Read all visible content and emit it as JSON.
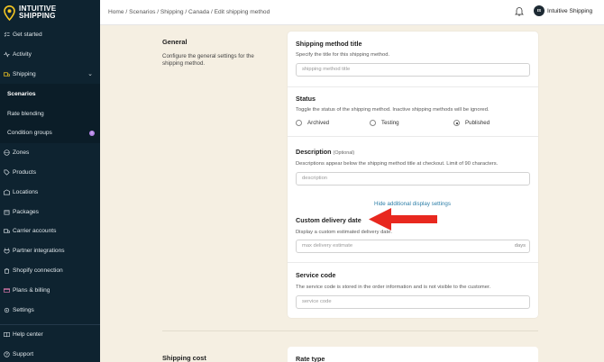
{
  "brand": {
    "line1": "INTUITIVE",
    "line2": "SHIPPING"
  },
  "sidebar": {
    "items": [
      {
        "label": "Get started",
        "icon": "checklist-icon"
      },
      {
        "label": "Activity",
        "icon": "activity-icon"
      },
      {
        "label": "Shipping",
        "icon": "truck-icon"
      },
      {
        "label": "Scenarios"
      },
      {
        "label": "Rate blending"
      },
      {
        "label": "Condition groups",
        "badge": "!"
      },
      {
        "label": "Zones",
        "icon": "globe-icon"
      },
      {
        "label": "Products",
        "icon": "tag-icon"
      },
      {
        "label": "Locations",
        "icon": "warehouse-icon"
      },
      {
        "label": "Packages",
        "icon": "box-icon"
      },
      {
        "label": "Carrier accounts",
        "icon": "truck-icon"
      },
      {
        "label": "Partner integrations",
        "icon": "plug-icon"
      },
      {
        "label": "Shopify connection",
        "icon": "shopify-icon"
      },
      {
        "label": "Plans & billing",
        "icon": "credit-card-icon"
      },
      {
        "label": "Settings",
        "icon": "gear-icon"
      },
      {
        "label": "Help center",
        "icon": "book-icon"
      },
      {
        "label": "Support",
        "icon": "help-icon"
      }
    ]
  },
  "topbar": {
    "breadcrumb": "Home / Scenarios / Shipping / Canada / Edit shipping method",
    "avatar_initials": "IS",
    "user_name": "Intuitive Shipping"
  },
  "general": {
    "title": "General",
    "description_line1": "Configure the general settings for the",
    "description_line2": "shipping method."
  },
  "form": {
    "method_title": {
      "label": "Shipping method title",
      "description": "Specify the title for this shipping method.",
      "placeholder": "shipping method title"
    },
    "status": {
      "label": "Status",
      "description": "Toggle the status of the shipping method. Inactive shipping methods will be ignored.",
      "options": [
        "Archived",
        "Testing",
        "Published"
      ],
      "selected": "Published"
    },
    "description": {
      "label": "Description",
      "optional": "(Optional)",
      "help": "Descriptions appear below the shipping method title at checkout. Limit of 90 characters.",
      "placeholder": "description"
    },
    "display_link": "Hide additional display settings",
    "custom_delivery": {
      "label": "Custom delivery date",
      "description": "Display a custom estimated delivery date.",
      "placeholder": "max delivery estimate",
      "suffix": "days"
    },
    "service_code": {
      "label": "Service code",
      "description": "The service code is stored in the order information and is not visible to the customer.",
      "placeholder": "service code"
    }
  },
  "shipping_cost": {
    "title": "Shipping cost",
    "rate_type_label": "Rate type"
  },
  "colors": {
    "sidebar_bg": "#0e2330",
    "page_bg": "#f5efe2",
    "arrow": "#e8281f",
    "link": "#2e7fa8"
  }
}
